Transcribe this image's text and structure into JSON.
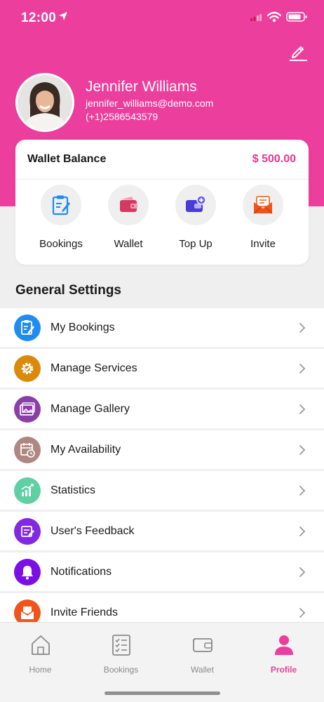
{
  "status_bar": {
    "time": "12:00"
  },
  "profile": {
    "name": "Jennifer Williams",
    "email": "jennifer_williams@demo.com",
    "phone": "(+1)2586543579"
  },
  "wallet": {
    "title": "Wallet Balance",
    "amount": "$ 500.00",
    "actions": [
      {
        "label": "Bookings",
        "icon": "clipboard-icon"
      },
      {
        "label": "Wallet",
        "icon": "wallet-icon"
      },
      {
        "label": "Top Up",
        "icon": "card-plus-icon"
      },
      {
        "label": "Invite",
        "icon": "envelope-icon"
      }
    ]
  },
  "settings": {
    "title": "General Settings",
    "items": [
      {
        "label": "My Bookings",
        "icon": "clipboard-icon",
        "color": "#1f8cf0"
      },
      {
        "label": "Manage Services",
        "icon": "gear-icon",
        "color": "#d98a0b"
      },
      {
        "label": "Manage Gallery",
        "icon": "gallery-icon",
        "color": "#8a3fa8"
      },
      {
        "label": "My Availability",
        "icon": "calendar-clock-icon",
        "color": "#ad8780"
      },
      {
        "label": "Statistics",
        "icon": "chart-icon",
        "color": "#5fcfa4"
      },
      {
        "label": "User's Feedback",
        "icon": "feedback-icon",
        "color": "#8228e3"
      },
      {
        "label": "Notifications",
        "icon": "bell-icon",
        "color": "#7b0fe6"
      },
      {
        "label": "Invite Friends",
        "icon": "envelope-icon",
        "color": "#f0541c"
      }
    ]
  },
  "tabs": [
    {
      "label": "Home",
      "icon": "home-icon",
      "active": false
    },
    {
      "label": "Bookings",
      "icon": "checklist-icon",
      "active": false
    },
    {
      "label": "Wallet",
      "icon": "wallet-icon",
      "active": false
    },
    {
      "label": "Profile",
      "icon": "person-icon",
      "active": true
    }
  ],
  "colors": {
    "brand": "#ec3e9c",
    "accent": "#e8368f"
  }
}
